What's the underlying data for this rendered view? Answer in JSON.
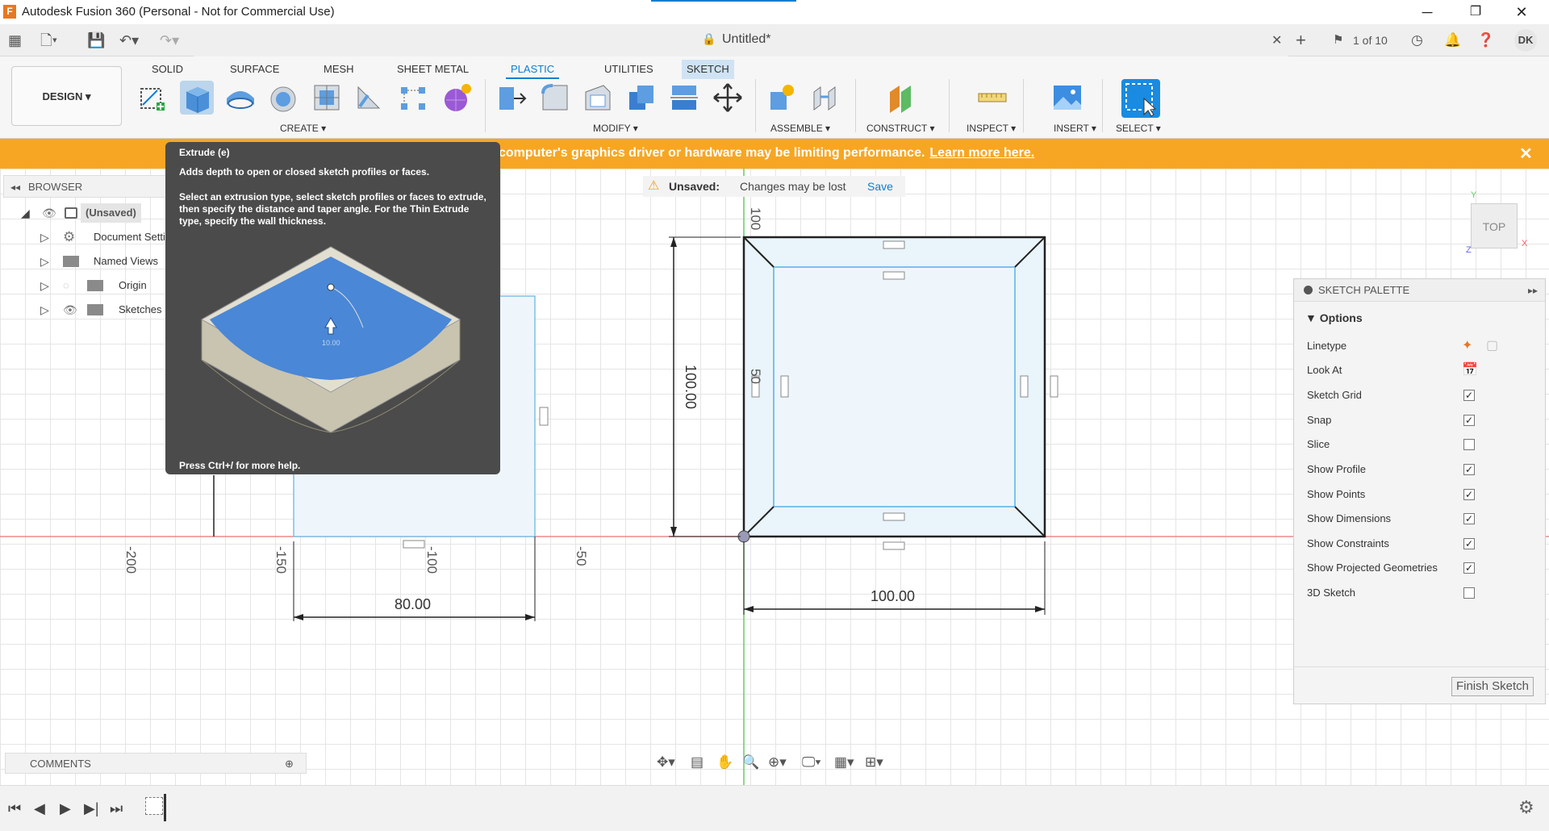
{
  "window": {
    "logo_letter": "F",
    "title": "Autodesk Fusion 360 (Personal - Not for Commercial Use)",
    "min": "─",
    "max": "❐",
    "close": "✕"
  },
  "tabbar": {
    "doc_title": "Untitled*",
    "doc_close": "✕",
    "page_count": "1 of 10",
    "user_initials": "DK"
  },
  "ribbon": {
    "workspace": "DESIGN ▾",
    "tabs": [
      "SOLID",
      "SURFACE",
      "MESH",
      "SHEET METAL",
      "PLASTIC",
      "UTILITIES",
      "SKETCH"
    ],
    "groups": [
      "CREATE ▾",
      "MODIFY ▾",
      "ASSEMBLE ▾",
      "CONSTRUCT ▾",
      "INSPECT ▾",
      "INSERT ▾",
      "SELECT ▾"
    ],
    "accent": "#0b7fd3"
  },
  "banner": {
    "message": "computer's graphics driver or hardware may be limiting performance.",
    "link": "Learn more here.",
    "close": "✕",
    "color": "#f7a623"
  },
  "browser": {
    "title": "BROWSER",
    "items": [
      {
        "label": "(Unsaved)"
      },
      {
        "label": "Document Setti"
      },
      {
        "label": "Named Views"
      },
      {
        "label": "Origin"
      },
      {
        "label": "Sketches"
      }
    ]
  },
  "tooltip": {
    "title": "Extrude (e)",
    "description": "Adds depth to open or closed sketch profiles or faces.",
    "detail": "Select an extrusion type, select sketch profiles or faces to extrude, then specify the distance and taper angle. For the Thin Extrude type, specify the wall thickness.",
    "illustration_value": "10.00",
    "help": "Press Ctrl+/ for more help."
  },
  "unsaved": {
    "label": "Unsaved:",
    "message": "Changes may be lost",
    "save": "Save"
  },
  "viewcube": {
    "face": "TOP",
    "x_axis": "X",
    "y_axis": "Y",
    "z_axis": "Z"
  },
  "canvas": {
    "axis_ticks": [
      "-200",
      "-150",
      "-100",
      "-50",
      "100",
      "50"
    ],
    "dim_left_width": "80.00",
    "dim_square_width": "100.00",
    "dim_square_height": "100.00"
  },
  "palette": {
    "title": "SKETCH PALETTE",
    "section": "Options",
    "rows": [
      {
        "label": "Linetype",
        "type": "icons"
      },
      {
        "label": "Look At",
        "type": "icon"
      },
      {
        "label": "Sketch Grid",
        "checked": true
      },
      {
        "label": "Snap",
        "checked": true
      },
      {
        "label": "Slice",
        "checked": false
      },
      {
        "label": "Show Profile",
        "checked": true
      },
      {
        "label": "Show Points",
        "checked": true
      },
      {
        "label": "Show Dimensions",
        "checked": true
      },
      {
        "label": "Show Constraints",
        "checked": true
      },
      {
        "label": "Show Projected Geometries",
        "checked": true
      },
      {
        "label": "3D Sketch",
        "checked": false
      }
    ],
    "finish": "Finish Sketch"
  },
  "comments": {
    "title": "COMMENTS"
  }
}
